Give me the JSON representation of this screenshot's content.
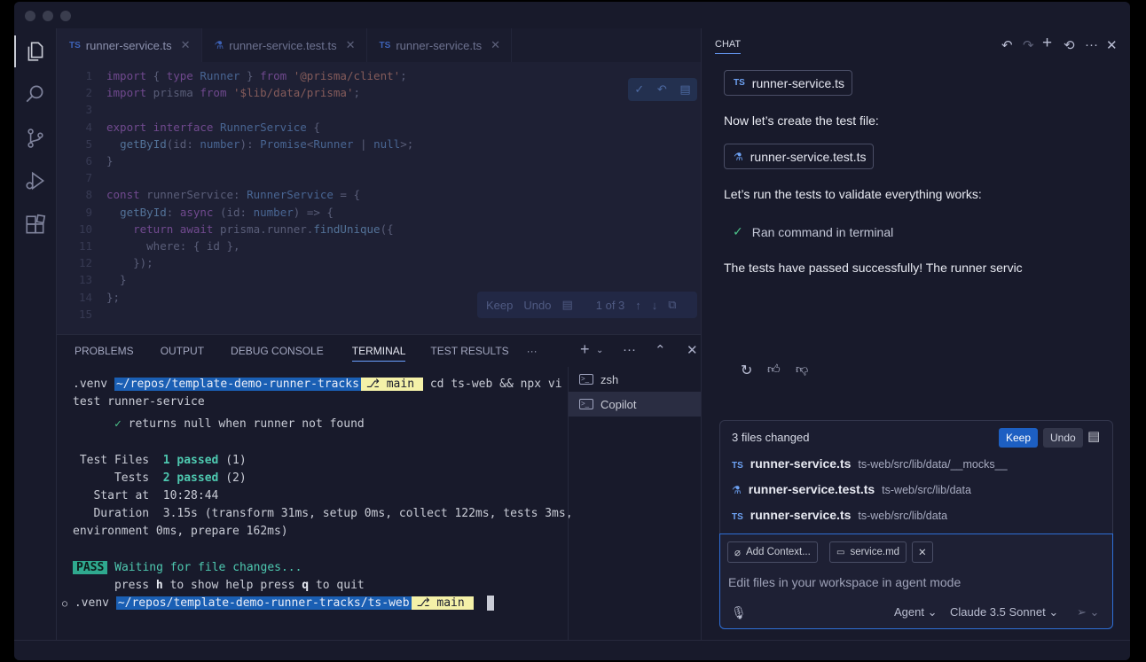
{
  "editor": {
    "tabs": [
      {
        "badge": "TS",
        "label": "runner-service.ts",
        "close": "✕"
      },
      {
        "badge": "",
        "label": "runner-service.test.ts",
        "close": "✕"
      },
      {
        "badge": "TS",
        "label": "runner-service.ts",
        "close": "✕"
      }
    ],
    "review": {
      "keep": "Keep",
      "undo": "Undo",
      "count": "1 of 3"
    }
  },
  "panel": {
    "tabs": [
      "PROBLEMS",
      "OUTPUT",
      "DEBUG CONSOLE",
      "TERMINAL",
      "TEST RESULTS",
      "···"
    ],
    "terminal": {
      "venv": ".venv",
      "path1": "~/repos/template-demo-runner-tracks",
      "branch": "main",
      "command": " cd ts-web && npx vi",
      "command_wrap": "test runner-service",
      "check_line": "returns null when runner not found",
      "test_files_label": " Test Files",
      "test_files_value": "1 passed",
      "test_files_count": " (1)",
      "tests_label": "      Tests",
      "tests_value": "2 passed",
      "tests_count": " (2)",
      "start_label": "   Start at",
      "start_value": "10:28:44",
      "duration_label": "   Duration",
      "duration_value": "3.15s",
      "duration_rest": " (transform 31ms, setup 0ms, collect 122ms, tests 3ms,",
      "duration_wrap": "environment 0ms, prepare 162ms)",
      "pass_badge": "PASS",
      "waiting": " Waiting for file changes...",
      "help_1": "      press ",
      "help_key_h": "h",
      "help_2": " to show help press ",
      "help_key_q": "q",
      "help_3": " to quit",
      "prompt_mark": "○",
      "path2": "~/repos/template-demo-runner-tracks/ts-web"
    },
    "terminal_list": [
      "zsh",
      "Copilot"
    ]
  },
  "chat": {
    "title": "CHAT",
    "file_chip_1": {
      "badge": "TS",
      "label": "runner-service.ts"
    },
    "msg_1": "Now let’s create the test file:",
    "file_chip_2": {
      "label": "runner-service.test.ts"
    },
    "msg_2": "Let’s run the tests to validate everything works:",
    "ran_command": "Ran command in terminal",
    "msg_3": "The tests have passed successfully! The runner servic",
    "changes": {
      "summary": "3 files changed",
      "keep": "Keep",
      "undo": "Undo",
      "files": [
        {
          "badge": "TS",
          "name": "runner-service.ts",
          "path": "ts-web/src/lib/data/__mocks__"
        },
        {
          "badge": "",
          "name": "runner-service.test.ts",
          "path": "ts-web/src/lib/data"
        },
        {
          "badge": "TS",
          "name": "runner-service.ts",
          "path": "ts-web/src/lib/data"
        }
      ]
    },
    "input": {
      "add_context": "Add Context...",
      "context_file": "service.md",
      "placeholder": "Edit files in your workspace in agent mode",
      "mode": "Agent",
      "model": "Claude 3.5 Sonnet"
    }
  },
  "colors": {
    "accent": "#1d5fc2",
    "window_bg": "#181a2b",
    "editor_bg": "#1e2034"
  }
}
